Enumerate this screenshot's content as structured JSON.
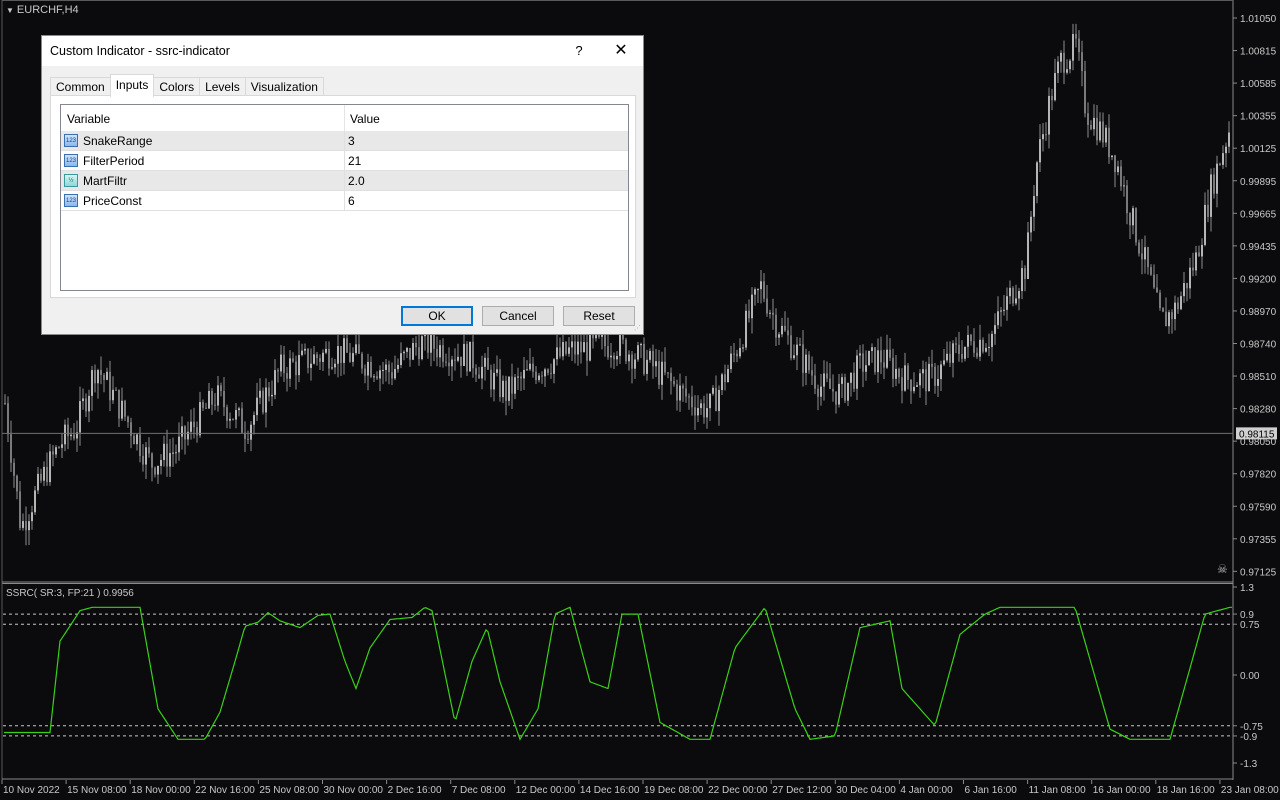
{
  "chart": {
    "symbol": "EURCHF,H4",
    "indicator_label": "SSRC( SR:3, FP:21 ) 0.9956",
    "current_price": "0.98115",
    "price_axis": [
      "1.01050",
      "1.00815",
      "1.00585",
      "1.00355",
      "1.00125",
      "0.99895",
      "0.99665",
      "0.99435",
      "0.99200",
      "0.98970",
      "0.98740",
      "0.98510",
      "0.98280",
      "0.98050",
      "0.97820",
      "0.97590",
      "0.97355",
      "0.97125"
    ],
    "indicator_axis": [
      "1.3",
      "0.9",
      "0.75",
      "0.00",
      "-0.75",
      "-0.9",
      "-1.3"
    ],
    "time_axis": [
      "10 Nov 2022",
      "15 Nov 08:00",
      "18 Nov 00:00",
      "22 Nov 16:00",
      "25 Nov 08:00",
      "30 Nov 00:00",
      "2 Dec 16:00",
      "7 Dec 08:00",
      "12 Dec 00:00",
      "14 Dec 16:00",
      "19 Dec 08:00",
      "22 Dec 00:00",
      "27 Dec 12:00",
      "30 Dec 04:00",
      "4 Jan 00:00",
      "6 Jan 16:00",
      "11 Jan 08:00",
      "16 Jan 00:00",
      "18 Jan 16:00",
      "23 Jan 08:00"
    ],
    "colors": {
      "background": "#0b0b0d",
      "candle": "#9a9a9a",
      "indicator": "#39d017",
      "grid_text": "#c8c8c8"
    },
    "price_key_points": [
      [
        0,
        0.9855
      ],
      [
        20,
        0.9745
      ],
      [
        45,
        0.9785
      ],
      [
        60,
        0.9805
      ],
      [
        75,
        0.9815
      ],
      [
        95,
        0.986
      ],
      [
        115,
        0.9835
      ],
      [
        150,
        0.979
      ],
      [
        175,
        0.98
      ],
      [
        215,
        0.9838
      ],
      [
        245,
        0.9815
      ],
      [
        280,
        0.9857
      ],
      [
        335,
        0.987
      ],
      [
        390,
        0.9855
      ],
      [
        420,
        0.9876
      ],
      [
        470,
        0.9865
      ],
      [
        505,
        0.984
      ],
      [
        530,
        0.9855
      ],
      [
        570,
        0.987
      ],
      [
        615,
        0.9875
      ],
      [
        650,
        0.986
      ],
      [
        680,
        0.984
      ],
      [
        700,
        0.983
      ],
      [
        710,
        0.983
      ],
      [
        735,
        0.987
      ],
      [
        760,
        0.9915
      ],
      [
        775,
        0.989
      ],
      [
        800,
        0.9865
      ],
      [
        820,
        0.9845
      ],
      [
        840,
        0.984
      ],
      [
        860,
        0.986
      ],
      [
        880,
        0.9865
      ],
      [
        905,
        0.985
      ],
      [
        930,
        0.985
      ],
      [
        960,
        0.9872
      ],
      [
        990,
        0.988
      ],
      [
        1010,
        0.991
      ],
      [
        1025,
        0.993
      ],
      [
        1035,
        1.0
      ],
      [
        1050,
        1.005
      ],
      [
        1060,
        1.0075
      ],
      [
        1075,
        1.0085
      ],
      [
        1085,
        1.004
      ],
      [
        1100,
        1.0025
      ],
      [
        1115,
        1.0005
      ],
      [
        1130,
        0.9965
      ],
      [
        1145,
        0.993
      ],
      [
        1160,
        0.989
      ],
      [
        1175,
        0.99
      ],
      [
        1195,
        0.9935
      ],
      [
        1210,
        0.9985
      ],
      [
        1232,
        1.0035
      ]
    ],
    "indicator_key_points": [
      [
        0,
        -0.85
      ],
      [
        50,
        -0.85
      ],
      [
        60,
        0.5
      ],
      [
        80,
        0.95
      ],
      [
        92,
        1.0
      ],
      [
        140,
        1.0
      ],
      [
        158,
        -0.5
      ],
      [
        178,
        -0.95
      ],
      [
        205,
        -0.95
      ],
      [
        220,
        -0.55
      ],
      [
        235,
        0.2
      ],
      [
        245,
        0.72
      ],
      [
        258,
        0.78
      ],
      [
        268,
        0.92
      ],
      [
        280,
        0.8
      ],
      [
        300,
        0.7
      ],
      [
        318,
        0.88
      ],
      [
        330,
        0.9
      ],
      [
        345,
        0.2
      ],
      [
        356,
        -0.2
      ],
      [
        370,
        0.4
      ],
      [
        390,
        0.82
      ],
      [
        412,
        0.85
      ],
      [
        425,
        1.0
      ],
      [
        432,
        0.95
      ],
      [
        455,
        -0.7
      ],
      [
        472,
        0.2
      ],
      [
        487,
        0.7
      ],
      [
        500,
        -0.1
      ],
      [
        520,
        -0.95
      ],
      [
        538,
        -0.5
      ],
      [
        555,
        0.9
      ],
      [
        570,
        1.0
      ],
      [
        590,
        -0.1
      ],
      [
        608,
        -0.2
      ],
      [
        622,
        0.9
      ],
      [
        638,
        0.9
      ],
      [
        660,
        -0.7
      ],
      [
        690,
        -0.95
      ],
      [
        710,
        -0.95
      ],
      [
        735,
        0.4
      ],
      [
        765,
        1.0
      ],
      [
        795,
        -0.5
      ],
      [
        810,
        -0.95
      ],
      [
        835,
        -0.9
      ],
      [
        860,
        0.7
      ],
      [
        875,
        0.75
      ],
      [
        890,
        0.8
      ],
      [
        902,
        -0.2
      ],
      [
        935,
        -0.75
      ],
      [
        960,
        0.6
      ],
      [
        985,
        0.9
      ],
      [
        1000,
        1.0
      ],
      [
        1075,
        1.0
      ],
      [
        1110,
        -0.8
      ],
      [
        1130,
        -0.95
      ],
      [
        1170,
        -0.95
      ],
      [
        1190,
        0.1
      ],
      [
        1205,
        0.9
      ],
      [
        1230,
        1.0
      ]
    ]
  },
  "dialog": {
    "title": "Custom Indicator - ssrc-indicator",
    "help": "?",
    "close": "✕",
    "tabs": [
      "Common",
      "Inputs",
      "Colors",
      "Levels",
      "Visualization"
    ],
    "table": {
      "headers": [
        "Variable",
        "Value"
      ],
      "rows": [
        {
          "icon": "123",
          "variable": "SnakeRange",
          "value": "3"
        },
        {
          "icon": "123",
          "variable": "FilterPeriod",
          "value": "21"
        },
        {
          "icon": "½",
          "variable": "MartFiltr",
          "value": "2.0"
        },
        {
          "icon": "123",
          "variable": "PriceConst",
          "value": "6"
        }
      ]
    },
    "buttons": {
      "ok": "OK",
      "cancel": "Cancel",
      "reset": "Reset"
    }
  }
}
